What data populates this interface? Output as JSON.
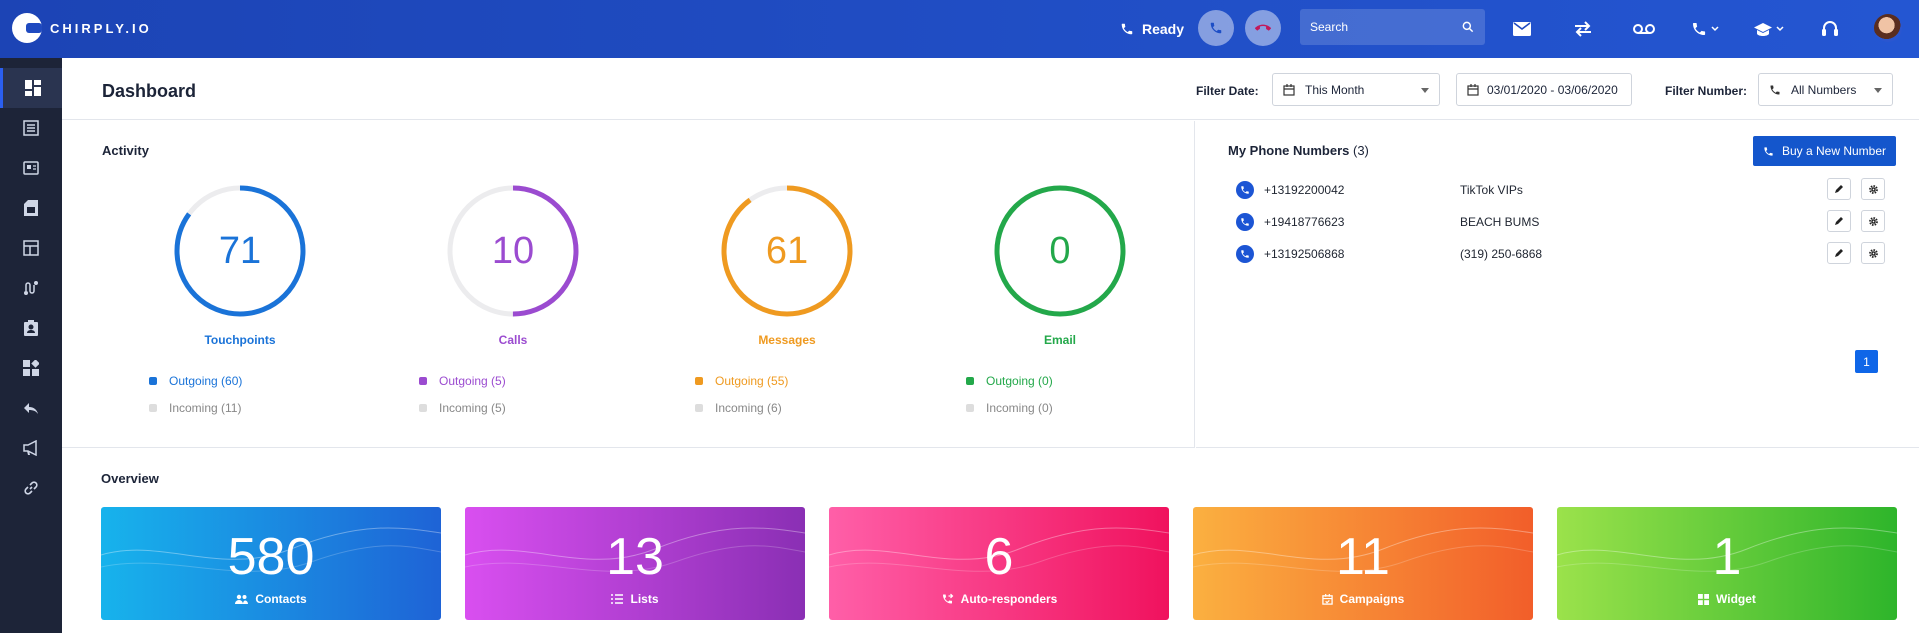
{
  "app": {
    "logo_text": "CHIRPLY.IO"
  },
  "topbar": {
    "status": "Ready",
    "search_placeholder": "Search",
    "icons": [
      "phone-ready-icon",
      "call-button",
      "hangup-button",
      "search-icon",
      "mail-icon",
      "transfer-icon",
      "voicemail-icon",
      "phone-dropdown-icon",
      "education-dropdown-icon",
      "headset-icon",
      "user-avatar"
    ]
  },
  "sidebar": {
    "items": [
      "dashboard",
      "lists",
      "contacts-card",
      "sim-card",
      "layout",
      "routing",
      "contact-badge",
      "widgets",
      "reply",
      "campaigns",
      "integrations"
    ]
  },
  "header": {
    "title": "Dashboard",
    "filter_date_label": "Filter Date:",
    "filter_date_value": "This Month",
    "date_range": "03/01/2020 - 03/06/2020",
    "filter_number_label": "Filter Number:",
    "filter_number_value": "All Numbers"
  },
  "activity": {
    "title": "Activity",
    "gauges": [
      {
        "value": "71",
        "label": "Touchpoints",
        "color": "#1a73d8",
        "fraction": 0.85,
        "outgoing": "Outgoing (60)",
        "incoming": "Incoming (11)"
      },
      {
        "value": "10",
        "label": "Calls",
        "color": "#9b4bd0",
        "fraction": 0.5,
        "outgoing": "Outgoing (5)",
        "incoming": "Incoming (5)"
      },
      {
        "value": "61",
        "label": "Messages",
        "color": "#ef9a20",
        "fraction": 0.9,
        "outgoing": "Outgoing (55)",
        "incoming": "Incoming (6)"
      },
      {
        "value": "0",
        "label": "Email",
        "color": "#23a84a",
        "fraction": 1.0,
        "outgoing": "Outgoing (0)",
        "incoming": "Incoming (0)"
      }
    ]
  },
  "phones": {
    "title": "My Phone Numbers",
    "count": "(3)",
    "buy_label": "Buy a New Number",
    "rows": [
      {
        "number": "+13192200042",
        "name": "TikTok VIPs"
      },
      {
        "number": "+19418776623",
        "name": "BEACH BUMS"
      },
      {
        "number": "+13192506868",
        "name": "(319) 250-6868"
      }
    ],
    "page": "1"
  },
  "overview": {
    "title": "Overview",
    "cards": [
      {
        "value": "580",
        "label": "Contacts",
        "icon": "contacts-icon",
        "from": "#17b3ec",
        "to": "#1e63d6"
      },
      {
        "value": "13",
        "label": "Lists",
        "icon": "list-icon",
        "from": "#d94ff0",
        "to": "#8a2fb4"
      },
      {
        "value": "6",
        "label": "Auto-responders",
        "icon": "auto-responder-icon",
        "from": "#ff5fa8",
        "to": "#f0125e"
      },
      {
        "value": "11",
        "label": "Campaigns",
        "icon": "calendar-icon",
        "from": "#fbb040",
        "to": "#f25e2a"
      },
      {
        "value": "1",
        "label": "Widget",
        "icon": "widget-icon",
        "from": "#9be24b",
        "to": "#2eb52b"
      }
    ]
  }
}
